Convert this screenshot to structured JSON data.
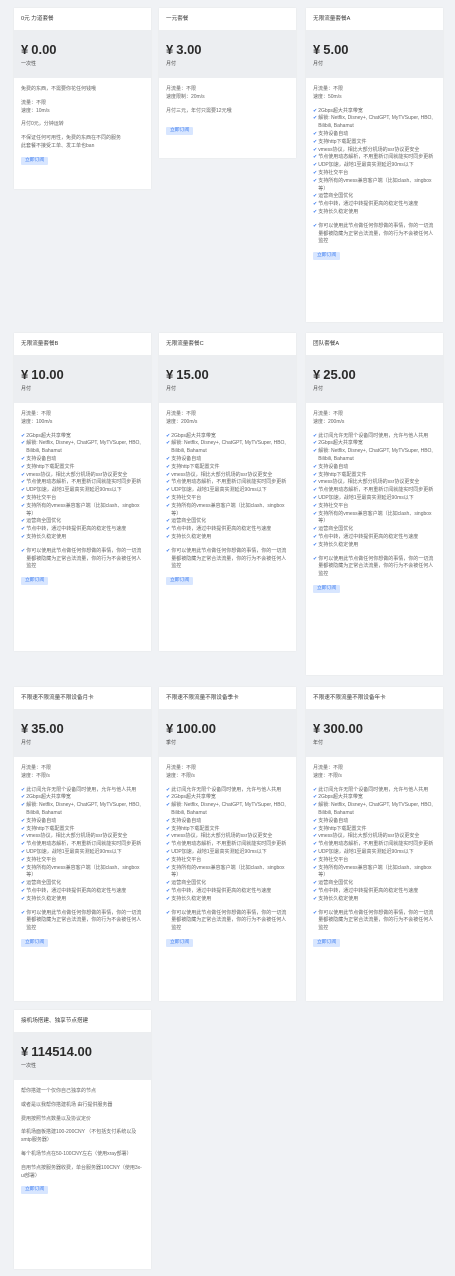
{
  "cards": [
    {
      "title": "0元 力道套餐",
      "currency": "¥",
      "price": "0.00",
      "period": "一次性",
      "info": [
        "免费的东西，不需要你花任何钱哦",
        "",
        "流量：不限",
        "速度：10m/s",
        "",
        "月付0元，分钟运转",
        "",
        "不保证任何可用性，免费的东西在不同的服务",
        "此套餐不接受工单、发工单也ban"
      ],
      "features": [],
      "footer": [],
      "button": "立即订阅"
    },
    {
      "title": "一元套餐",
      "currency": "¥",
      "price": "3.00",
      "period": "月付",
      "info": [
        "月流量：不限",
        "速度限制：20m/s",
        "",
        "月付三元，年付只需要12元哦",
        ""
      ],
      "features": [],
      "footer": [],
      "button": "立即订阅"
    },
    {
      "title": "无限流量套餐A",
      "currency": "¥",
      "price": "5.00",
      "period": "月付",
      "info": [
        "月流量：不限",
        "速度：50m/s"
      ],
      "features": [
        "2Gbps超大共享带宽",
        "解锁: Netflix, Disney+, ChatGPT, MyTVSuper, HBO, Bilibili, Bahamut",
        "支持设备自动",
        "支持http下载配置文件",
        "vmess协议，相比大部分机场的ssr协议更安全",
        "节点使用动态解析，不用重新订阅就能实时同步更新",
        "UDP加速，战地1至最高实测延迟90ms以下",
        "支持社交平台",
        "支持所有的vmess兼容客户端（比如clash、singbox等）",
        "运营商全国优化",
        "节点中转，通过中转提供更高的稳定性与速度",
        "支持长久稳定使用"
      ],
      "footer": [
        "你可以使用此节点做任何你想做的事情，你的一切流量都被隐藏为正常合法流量，你的行为不会被任何人监控"
      ],
      "button": "立即订阅"
    },
    {
      "title": "无限流量套餐B",
      "currency": "¥",
      "price": "10.00",
      "period": "月付",
      "info": [
        "月流量：不限",
        "速度：100m/s"
      ],
      "features": [
        "2Gbps超大共享带宽",
        "解锁: Netflix, Disney+, ChatGPT, MyTVSuper, HBO, Bilibili, Bahamut",
        "支持设备自动",
        "支持http下载配置文件",
        "vmess协议，相比大部分机场的ssr协议更安全",
        "节点使用动态解析，不用重新订阅就能实时同步更新",
        "UDP加速，战地1至最高实测延迟90ms以下",
        "支持社交平台",
        "支持所有的vmess兼容客户端（比如clash、singbox等）",
        "运营商全国优化",
        "节点中转，通过中转提供更高的稳定性与速度",
        "支持长久稳定使用"
      ],
      "footer": [
        "你可以使用此节点做任何你想做的事情，你的一切流量都被隐藏为正常合法流量，你的行为不会被任何人监控"
      ],
      "button": "立即订阅"
    },
    {
      "title": "无限流量套餐C",
      "currency": "¥",
      "price": "15.00",
      "period": "月付",
      "info": [
        "月流量：不限",
        "速度：200m/s"
      ],
      "features": [
        "2Gbps超大共享带宽",
        "解锁: Netflix, Disney+, ChatGPT, MyTVSuper, HBO, Bilibili, Bahamut",
        "支持设备自动",
        "支持http下载配置文件",
        "vmess协议，相比大部分机场的ssr协议更安全",
        "节点使用动态解析，不用重新订阅就能实时同步更新",
        "UDP加速，战地1至最高实测延迟90ms以下",
        "支持社交平台",
        "支持所有的vmess兼容客户端（比如clash、singbox等）",
        "运营商全国优化",
        "节点中转，通过中转提供更高的稳定性与速度",
        "支持长久稳定使用"
      ],
      "footer": [
        "你可以使用此节点做任何你想做的事情，你的一切流量都被隐藏为正常合法流量，你的行为不会被任何人监控"
      ],
      "button": "立即订阅"
    },
    {
      "title": "团队套餐A",
      "currency": "¥",
      "price": "25.00",
      "period": "月付",
      "info": [
        "月流量：不限",
        "速度：200m/s"
      ],
      "features": [
        "此订阅允许无限个设备同时使用，允许与他人共用",
        "2Gbps超大共享带宽",
        "解锁: Netflix, Disney+, ChatGPT, MyTVSuper, HBO, Bilibili, Bahamut",
        "支持设备自动",
        "支持http下载配置文件",
        "vmess协议，相比大部分机场的ssr协议更安全",
        "节点使用动态解析，不用重新订阅就能实时同步更新",
        "UDP加速，战地1至最高实测延迟90ms以下",
        "支持社交平台",
        "支持所有的vmess兼容客户端（比如clash、singbox等）",
        "运营商全国优化",
        "节点中转，通过中转提供更高的稳定性与速度",
        "支持长久稳定使用"
      ],
      "footer": [
        "你可以使用此节点做任何你想做的事情，你的一切流量都被隐藏为正常合法流量，你的行为不会被任何人监控"
      ],
      "button": "立即订阅"
    },
    {
      "title": "不限速不限流量不限设备月卡",
      "currency": "¥",
      "price": "35.00",
      "period": "月付",
      "info": [
        "月流量：不限",
        "速度：不限/s"
      ],
      "features": [
        "此订阅允许无限个设备同时使用，允许与他人共用",
        "2Gbps超大共享带宽",
        "解锁: Netflix, Disney+, ChatGPT, MyTVSuper, HBO, Bilibili, Bahamut",
        "支持设备自动",
        "支持http下载配置文件",
        "vmess协议，相比大部分机场的ssr协议更安全",
        "节点使用动态解析，不用重新订阅就能实时同步更新",
        "UDP加速，战地1至最高实测延迟90ms以下",
        "支持社交平台",
        "支持所有的vmess兼容客户端（比如clash、singbox等）",
        "运营商全国优化",
        "节点中转，通过中转提供更高的稳定性与速度",
        "支持长久稳定使用"
      ],
      "footer": [
        "你可以使用此节点做任何你想做的事情，你的一切流量都被隐藏为正常合法流量，你的行为不会被任何人监控"
      ],
      "button": "立即订阅"
    },
    {
      "title": "不限速不限流量不限设备季卡",
      "currency": "¥",
      "price": "100.00",
      "period": "季付",
      "info": [
        "月流量：不限",
        "速度：不限/s"
      ],
      "features": [
        "此订阅允许无限个设备同时使用，允许与他人共用",
        "2Gbps超大共享带宽",
        "解锁: Netflix, Disney+, ChatGPT, MyTVSuper, HBO, Bilibili, Bahamut",
        "支持设备自动",
        "支持http下载配置文件",
        "vmess协议，相比大部分机场的ssr协议更安全",
        "节点使用动态解析，不用重新订阅就能实时同步更新",
        "UDP加速，战地1至最高实测延迟90ms以下",
        "支持社交平台",
        "支持所有的vmess兼容客户端（比如clash、singbox等）",
        "运营商全国优化",
        "节点中转，通过中转提供更高的稳定性与速度",
        "支持长久稳定使用"
      ],
      "footer": [
        "你可以使用此节点做任何你想做的事情，你的一切流量都被隐藏为正常合法流量，你的行为不会被任何人监控"
      ],
      "button": "立即订阅"
    },
    {
      "title": "不限速不限流量不限设备年卡",
      "currency": "¥",
      "price": "300.00",
      "period": "年付",
      "info": [
        "月流量：不限",
        "速度：不限/s"
      ],
      "features": [
        "此订阅允许无限个设备同时使用，允许与他人共用",
        "2Gbps超大共享带宽",
        "解锁: Netflix, Disney+, ChatGPT, MyTVSuper, HBO, Bilibili, Bahamut",
        "支持设备自动",
        "支持http下载配置文件",
        "vmess协议，相比大部分机场的ssr协议更安全",
        "节点使用动态解析，不用重新订阅就能实时同步更新",
        "UDP加速，战地1至最高实测延迟90ms以下",
        "支持社交平台",
        "支持所有的vmess兼容客户端（比如clash、singbox等）",
        "运营商全国优化",
        "节点中转，通过中转提供更高的稳定性与速度",
        "支持长久稳定使用"
      ],
      "footer": [
        "你可以使用此节点做任何你想做的事情，你的一切流量都被隐藏为正常合法流量，你的行为不会被任何人监控"
      ],
      "button": "立即订阅"
    },
    {
      "title": "接机场搭建、独享节点搭建",
      "currency": "¥",
      "price": "114514.00",
      "period": "一次性",
      "info": [
        "帮你搭建一个仅你自己独享的节点",
        "",
        "或者是以我帮你搭建机场 由行提供服务器",
        "",
        "费用按照节点数量以及协议定价",
        "",
        "单机场面板搭建100-200CNY （不包括支付系统以及smtp服务器）",
        "",
        "每个机场节点在50-100CNY左右（使用xray部署）",
        "",
        "自用节点按服务器收费，单台服务器100CNY（使用3x-ui部署）"
      ],
      "features": [],
      "footer": [],
      "button": "立即订阅"
    }
  ]
}
